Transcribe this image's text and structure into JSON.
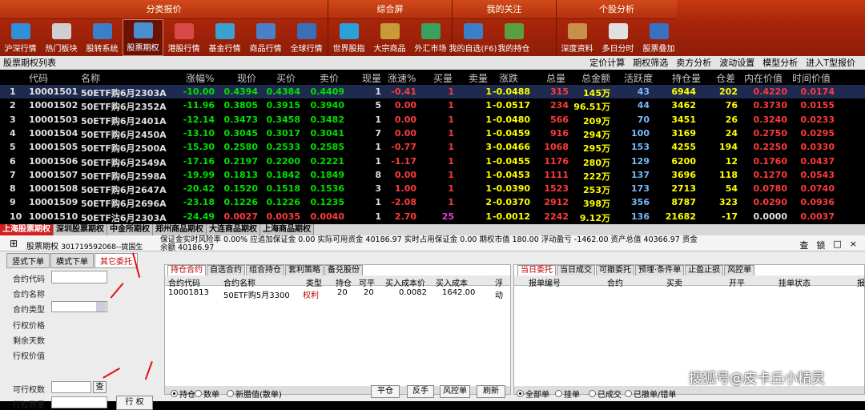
{
  "toolbar": {
    "groups": [
      {
        "title": "分类报价",
        "items": [
          "沪深行情",
          "热门板块",
          "股转系统",
          "股票期权",
          "港股行情",
          "基金行情",
          "商品行情",
          "全球行情"
        ]
      },
      {
        "title": "综合屏",
        "items": [
          "世界股指",
          "大宗商品",
          "外汇市场"
        ]
      },
      {
        "title": "我的关注",
        "items": [
          "我的自选(F6)",
          "我的持仓"
        ]
      },
      {
        "title": "个股分析",
        "items": [
          "深度资料",
          "多日分时",
          "股票叠加"
        ]
      }
    ],
    "active": "股票期权"
  },
  "listbar": {
    "title": "股票期权列表",
    "links": [
      "定价计算",
      "期权筛选",
      "卖方分析",
      "波动设置",
      "模型分析",
      "进入T型报价"
    ]
  },
  "table": {
    "headers": [
      "代码",
      "名称",
      "涨幅%",
      "现价",
      "买价",
      "卖价",
      "现量",
      "涨速%",
      "买量",
      "卖量",
      "涨跌",
      "总量",
      "总金额",
      "活跃度",
      "持仓量",
      "仓差",
      "内在价值",
      "时间价值"
    ],
    "rows": [
      [
        "1",
        "10001501",
        "50ETF购6月2303A",
        "-10.00",
        "0.4394",
        "0.4384",
        "0.4409",
        "1",
        "-0.41",
        "1",
        "1",
        "-0.0488",
        "315",
        "145万",
        "43",
        "6944",
        "202",
        "0.4220",
        "0.0174"
      ],
      [
        "2",
        "10001502",
        "50ETF购6月2352A",
        "-11.96",
        "0.3805",
        "0.3915",
        "0.3940",
        "5",
        "0.00",
        "1",
        "1",
        "-0.0517",
        "234",
        "96.51万",
        "44",
        "3462",
        "76",
        "0.3730",
        "0.0155"
      ],
      [
        "3",
        "10001503",
        "50ETF购6月2401A",
        "-12.14",
        "0.3473",
        "0.3458",
        "0.3482",
        "1",
        "0.00",
        "1",
        "1",
        "-0.0480",
        "566",
        "209万",
        "70",
        "3451",
        "26",
        "0.3240",
        "0.0233"
      ],
      [
        "4",
        "10001504",
        "50ETF购6月2450A",
        "-13.10",
        "0.3045",
        "0.3017",
        "0.3041",
        "7",
        "0.00",
        "1",
        "1",
        "-0.0459",
        "916",
        "294万",
        "100",
        "3169",
        "24",
        "0.2750",
        "0.0295"
      ],
      [
        "5",
        "10001505",
        "50ETF购6月2500A",
        "-15.30",
        "0.2580",
        "0.2533",
        "0.2585",
        "1",
        "-0.77",
        "1",
        "3",
        "-0.0466",
        "1068",
        "295万",
        "153",
        "4255",
        "194",
        "0.2250",
        "0.0330"
      ],
      [
        "6",
        "10001506",
        "50ETF购6月2549A",
        "-17.16",
        "0.2197",
        "0.2200",
        "0.2221",
        "1",
        "-1.17",
        "1",
        "1",
        "-0.0455",
        "1176",
        "280万",
        "129",
        "6200",
        "12",
        "0.1760",
        "0.0437"
      ],
      [
        "7",
        "10001507",
        "50ETF购6月2598A",
        "-19.99",
        "0.1813",
        "0.1842",
        "0.1849",
        "8",
        "0.00",
        "1",
        "1",
        "-0.0453",
        "1111",
        "222万",
        "137",
        "3696",
        "118",
        "0.1270",
        "0.0543"
      ],
      [
        "8",
        "10001508",
        "50ETF购6月2647A",
        "-20.42",
        "0.1520",
        "0.1518",
        "0.1536",
        "3",
        "1.00",
        "1",
        "1",
        "-0.0390",
        "1523",
        "253万",
        "173",
        "2713",
        "54",
        "0.0780",
        "0.0740"
      ],
      [
        "9",
        "10001509",
        "50ETF购6月2696A",
        "-23.18",
        "0.1226",
        "0.1226",
        "0.1235",
        "1",
        "-2.08",
        "1",
        "2",
        "-0.0370",
        "2912",
        "398万",
        "356",
        "8787",
        "323",
        "0.0290",
        "0.0936"
      ],
      [
        "10",
        "10001510",
        "50ETF沽6月2303A",
        "-24.49",
        "0.0027",
        "0.0035",
        "0.0040",
        "1",
        "2.70",
        "25",
        "1",
        "-0.0012",
        "2242",
        "9.12万",
        "136",
        "21682",
        "-17",
        "0.0000",
        "0.0037"
      ]
    ]
  },
  "exchange_tabs": [
    "上海股票期权",
    "深圳股票期权",
    "中金所期权",
    "郑州商品期权",
    "大连商品期权",
    "上海商品期权"
  ],
  "account": {
    "name": "股票期权",
    "account_id": "301719592068--拢国生",
    "line1": "保证金实时风险率 0.00% 应追加保证金 0.00 实际可用资金 40186.97 实时占用保证金 0.00 期权市值 180.00 浮动盈亏 -1462.00 资产总值 40366.97 资金",
    "line2": "余额 40186.97",
    "controls": [
      "查",
      "锁",
      "□",
      "×"
    ]
  },
  "order_form": {
    "tabs": [
      "竖式下单",
      "横式下单",
      "其它委托"
    ],
    "fields": [
      "合约代码",
      "合约名称",
      "合约类型",
      "行权价格",
      "剩余天数",
      "行权价值",
      "可行权数",
      "行权数量"
    ],
    "query_btn": "查",
    "exercise_btn": "行 权"
  },
  "positions": {
    "tabs": [
      "持仓合约",
      "自选合约",
      "组合持仓",
      "套利策略",
      "备兑股份"
    ],
    "headers": [
      "合约代码",
      "合约名称",
      "类型",
      "持仓",
      "可平",
      "买入成本价",
      "买入成本",
      "浮动"
    ],
    "rows": [
      [
        "10001813",
        "50ETF购5月3300",
        "权利",
        "20",
        "20",
        "0.0082",
        "1642.00"
      ]
    ]
  },
  "orders": {
    "tabs": [
      "当日委托",
      "当日成交",
      "可撤委托",
      "预埋·条件单",
      "止盈止损",
      "风控单"
    ],
    "headers": [
      "报单编号",
      "合约",
      "买卖",
      "开平",
      "挂单状态",
      "报"
    ]
  },
  "bottom_bar": {
    "radios": [
      "持仓",
      "数单",
      "新腊值(散单)"
    ],
    "buttons": [
      "平仓",
      "反手",
      "风控单",
      "刷新"
    ],
    "radios2": [
      "全部单",
      "挂单",
      "已成交",
      "已撤单/错单"
    ]
  },
  "watermark": "搜狐号@皮卡丘小精灵"
}
